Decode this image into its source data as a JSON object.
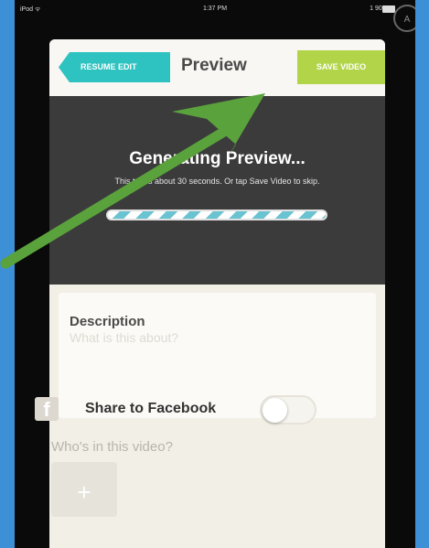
{
  "status_bar": {
    "carrier": "iPod ᯤ",
    "time": "1:37 PM",
    "battery": "1 90%"
  },
  "corner_button": {
    "label": "A"
  },
  "navbar": {
    "resume_label": "RESUME EDIT",
    "title": "Preview",
    "save_label": "SAVE VIDEO"
  },
  "preview": {
    "title": "Generating Preview...",
    "subtitle": "This takes about 30 seconds. Or tap Save Video to skip.",
    "progress": 1.0
  },
  "description": {
    "label": "Description",
    "placeholder": "What is this about?",
    "value": ""
  },
  "share": {
    "icon_glyph": "f",
    "label": "Share to Facebook",
    "enabled": false
  },
  "people": {
    "label": "Who's in this video?",
    "add_glyph": "+"
  },
  "colors": {
    "resume_button": "#2ec3c0",
    "save_button": "#b1d449",
    "preview_background": "#3b3b3b",
    "annotation_arrow": "#5aa23c",
    "page_frame": "#3d8fd6"
  },
  "icons": {
    "share": "facebook-icon",
    "annotation": "arrow-annotation-icon"
  }
}
